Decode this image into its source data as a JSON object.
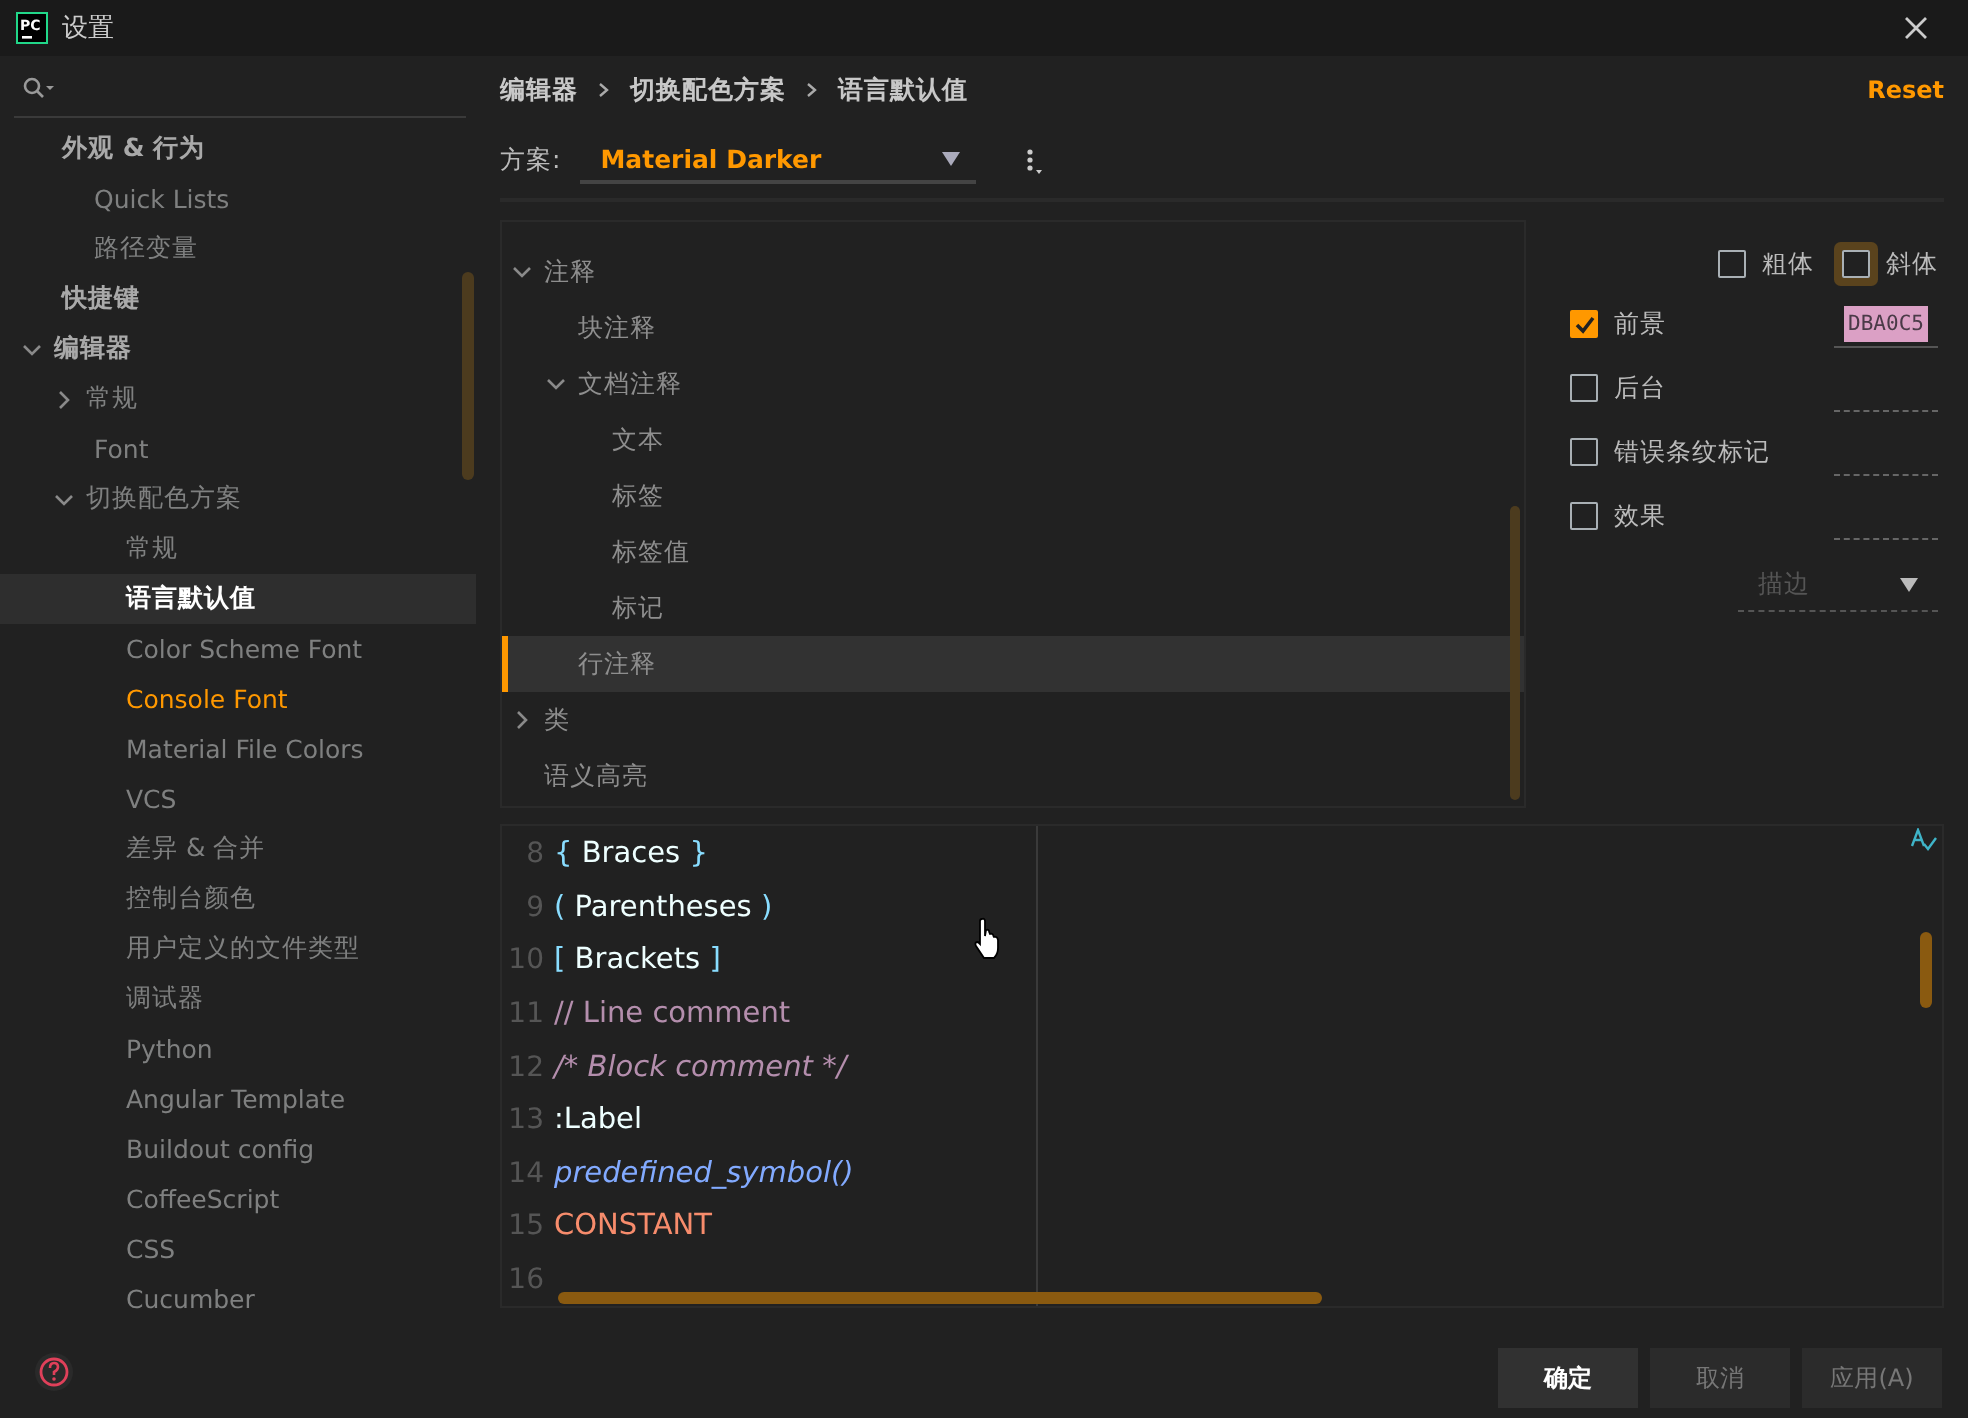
{
  "window": {
    "title": "设置",
    "logo": "PC"
  },
  "sidebar": {
    "items": [
      {
        "label": "外观 & 行为",
        "selected": false,
        "children": [
          {
            "label": "Quick Lists",
            "selected": false
          },
          {
            "label": "路径变量",
            "selected": false
          }
        ]
      },
      {
        "label": "快捷键",
        "selected": false
      },
      {
        "label": "编辑器",
        "selected": false,
        "expanded": true,
        "children": [
          {
            "label": "常规",
            "selected": false,
            "expanded": false
          },
          {
            "label": "Font",
            "selected": false
          },
          {
            "label": "切换配色方案",
            "selected": false,
            "expanded": true,
            "children": [
              {
                "label": "常规",
                "selected": false
              },
              {
                "label": "语言默认值",
                "selected": true
              },
              {
                "label": "Color Scheme Font",
                "selected": false
              },
              {
                "label": "Console Font",
                "selected": false,
                "modified": true
              },
              {
                "label": "Material File Colors",
                "selected": false
              },
              {
                "label": "VCS",
                "selected": false
              },
              {
                "label": "差异 & 合并",
                "selected": false
              },
              {
                "label": "控制台颜色",
                "selected": false
              },
              {
                "label": "用户定义的文件类型",
                "selected": false
              },
              {
                "label": "调试器",
                "selected": false
              },
              {
                "label": "Python",
                "selected": false
              },
              {
                "label": "Angular Template",
                "selected": false
              },
              {
                "label": "Buildout config",
                "selected": false
              },
              {
                "label": "CoffeeScript",
                "selected": false
              },
              {
                "label": "CSS",
                "selected": false
              },
              {
                "label": "Cucumber",
                "selected": false
              }
            ]
          }
        ]
      }
    ]
  },
  "breadcrumbs": [
    "编辑器",
    "切换配色方案",
    "语言默认值"
  ],
  "reset": "Reset",
  "scheme": {
    "label": "方案:",
    "value": "Material Darker"
  },
  "tree": {
    "items": [
      {
        "label": "注释",
        "selected": false,
        "expanded": true,
        "children": [
          {
            "label": "块注释",
            "selected": false
          },
          {
            "label": "文档注释",
            "selected": false,
            "expanded": true,
            "children": [
              {
                "label": "文本",
                "selected": false
              },
              {
                "label": "标签",
                "selected": false
              },
              {
                "label": "标签值",
                "selected": false
              },
              {
                "label": "标记",
                "selected": false
              }
            ]
          },
          {
            "label": "行注释",
            "selected": true
          }
        ]
      },
      {
        "label": "类",
        "selected": false,
        "expanded": false
      },
      {
        "label": "语义高亮",
        "selected": false
      }
    ]
  },
  "font_style": [
    {
      "label": "粗体",
      "checked": false,
      "focused": false
    },
    {
      "label": "斜体",
      "checked": false,
      "focused": true
    }
  ],
  "color_rows": [
    {
      "label": "前景",
      "checked": true,
      "value": "DBA0C5",
      "color": "#dba0c5"
    },
    {
      "label": "后台",
      "checked": false
    },
    {
      "label": "错误条纹标记",
      "checked": false
    },
    {
      "label": "效果",
      "checked": false
    }
  ],
  "effect": {
    "value": "描边",
    "disabled": true
  },
  "preview": {
    "lines": [
      {
        "number": "8",
        "tokens": [
          {
            "text": "{",
            "kind": "brace"
          },
          {
            "text": " Braces ",
            "kind": "plain"
          },
          {
            "text": "}",
            "kind": "brace"
          }
        ]
      },
      {
        "number": "9",
        "tokens": [
          {
            "text": "(",
            "kind": "brace"
          },
          {
            "text": " Parentheses ",
            "kind": "plain"
          },
          {
            "text": ")",
            "kind": "brace"
          }
        ]
      },
      {
        "number": "10",
        "tokens": [
          {
            "text": "[",
            "kind": "brace"
          },
          {
            "text": " Brackets ",
            "kind": "plain"
          },
          {
            "text": "]",
            "kind": "brace"
          }
        ]
      },
      {
        "number": "11",
        "tokens": [
          {
            "text": "// Line comment",
            "kind": "line_comment"
          }
        ]
      },
      {
        "number": "12",
        "tokens": [
          {
            "text": "/* Block comment */",
            "kind": "block_comment"
          }
        ]
      },
      {
        "number": "13",
        "tokens": [
          {
            "text": ":Label",
            "kind": "plain"
          }
        ]
      },
      {
        "number": "14",
        "tokens": [
          {
            "text": "predefined_symbol()",
            "kind": "predefined"
          }
        ]
      },
      {
        "number": "15",
        "tokens": [
          {
            "text": "CONSTANT",
            "kind": "constant"
          }
        ]
      },
      {
        "number": "16"
      }
    ]
  },
  "buttons": [
    {
      "label": "确定",
      "kind": "primary"
    },
    {
      "label": "取消",
      "kind": "normal"
    },
    {
      "label": "应用(A)",
      "kind": "normal"
    }
  ]
}
